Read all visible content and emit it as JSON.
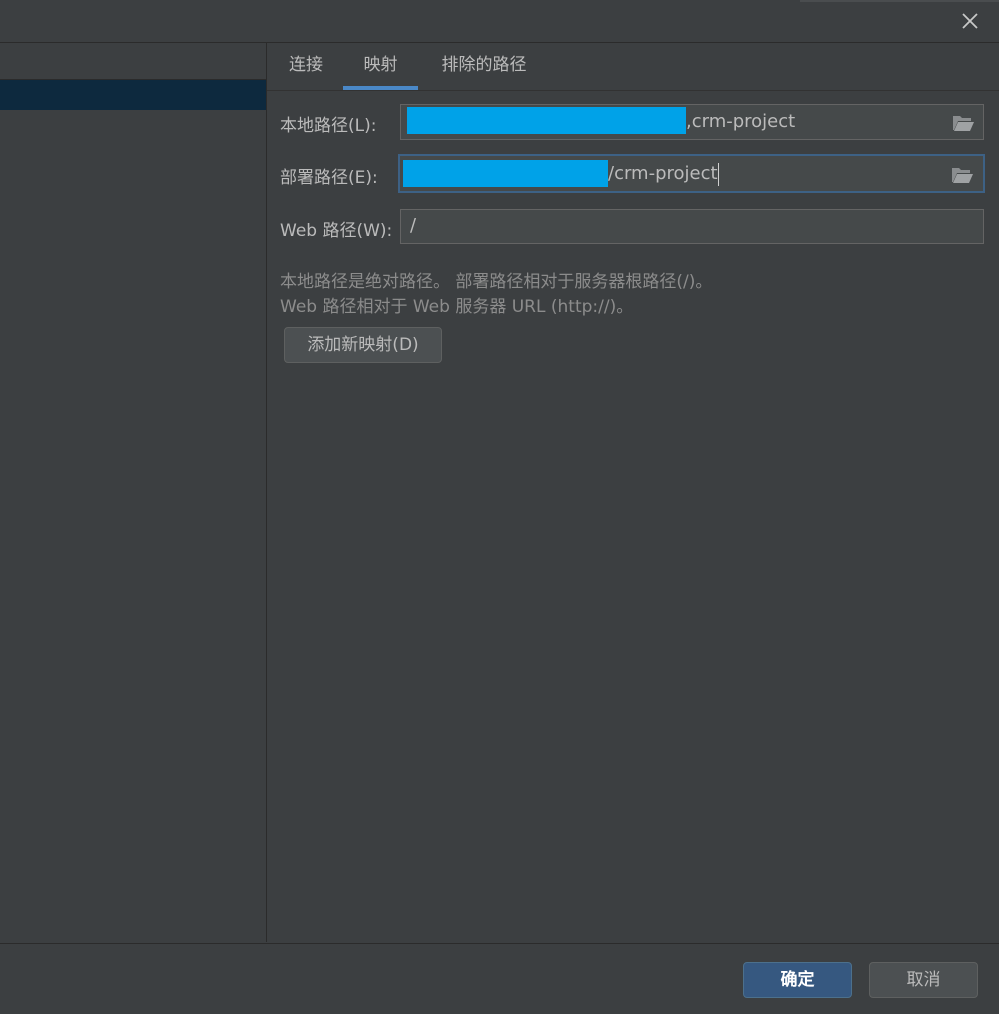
{
  "dialog": {
    "close_icon": "close-icon"
  },
  "tabs": [
    {
      "label": "连接",
      "active": false
    },
    {
      "label": "映射",
      "active": true
    },
    {
      "label": "排除的路径",
      "active": false
    }
  ],
  "mapping": {
    "local_path": {
      "label": "本地路径(L):",
      "value_suffix": ",crm-project",
      "icon": "folder-open-icon"
    },
    "deploy_path": {
      "label": "部署路径(E):",
      "value_suffix": "/crm-project",
      "icon": "folder-open-icon"
    },
    "web_path": {
      "label": "Web 路径(W):",
      "value": "/"
    },
    "help_line1": "本地路径是绝对路径。 部署路径相对于服务器根路径(/)。",
    "help_line2": "Web 路径相对于 Web 服务器 URL (http://)。",
    "add_mapping_button": "添加新映射(D)"
  },
  "footer": {
    "ok_button": "确定",
    "cancel_button": "取消"
  },
  "colors": {
    "background": "#3c3f41",
    "selection": "#0d293e",
    "accent": "#4a88c7",
    "redaction": "#00a2e8",
    "primary_button": "#365880"
  }
}
